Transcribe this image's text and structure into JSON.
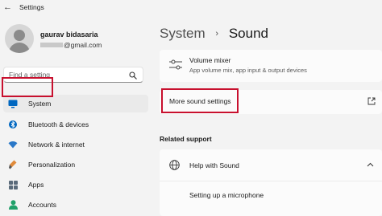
{
  "window": {
    "title": "Settings"
  },
  "user": {
    "name": "gaurav bidasaria",
    "email": "@gmail.com"
  },
  "search": {
    "placeholder": "Find a setting"
  },
  "nav": [
    {
      "label": "System",
      "icon": "system-icon"
    },
    {
      "label": "Bluetooth & devices",
      "icon": "bluetooth-icon"
    },
    {
      "label": "Network & internet",
      "icon": "wifi-icon"
    },
    {
      "label": "Personalization",
      "icon": "brush-icon"
    },
    {
      "label": "Apps",
      "icon": "apps-icon"
    },
    {
      "label": "Accounts",
      "icon": "accounts-icon"
    }
  ],
  "breadcrumb": {
    "parent": "System",
    "separator": "›",
    "current": "Sound"
  },
  "volume_mixer": {
    "title": "Volume mixer",
    "description": "App volume mix, app input & output devices"
  },
  "more_sound": {
    "label": "More sound settings"
  },
  "related": {
    "heading": "Related support",
    "help_title": "Help with Sound",
    "links": [
      "Setting up a microphone"
    ]
  },
  "colors": {
    "highlight": "#c8102e",
    "accent": "#0067c0",
    "background": "#f3f3f3"
  }
}
